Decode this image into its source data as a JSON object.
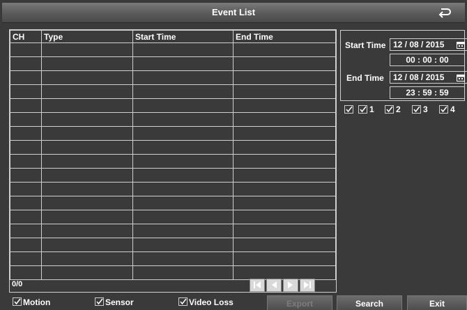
{
  "title": "Event List",
  "table": {
    "headers": [
      "CH",
      "Type",
      "Start Time",
      "End Time"
    ],
    "rows": []
  },
  "pagination": {
    "count_text": "0/0"
  },
  "filter": {
    "start_label": "Start Time",
    "start_date": "12 / 08 / 2015",
    "start_time": "00  :  00  :  00",
    "end_label": "End Time",
    "end_date": "12 / 08 / 2015",
    "end_time": "23  :  59  :  59"
  },
  "channels": [
    "1",
    "2",
    "3",
    "4"
  ],
  "event_types": [
    "Motion",
    "Sensor",
    "Video Loss"
  ],
  "buttons": {
    "export": "Export",
    "search": "Search",
    "exit": "Exit"
  },
  "icons": [
    "back-icon",
    "calendar-icon",
    "first-page-icon",
    "prev-page-icon",
    "next-page-icon",
    "last-page-icon",
    "checkbox-icon"
  ]
}
